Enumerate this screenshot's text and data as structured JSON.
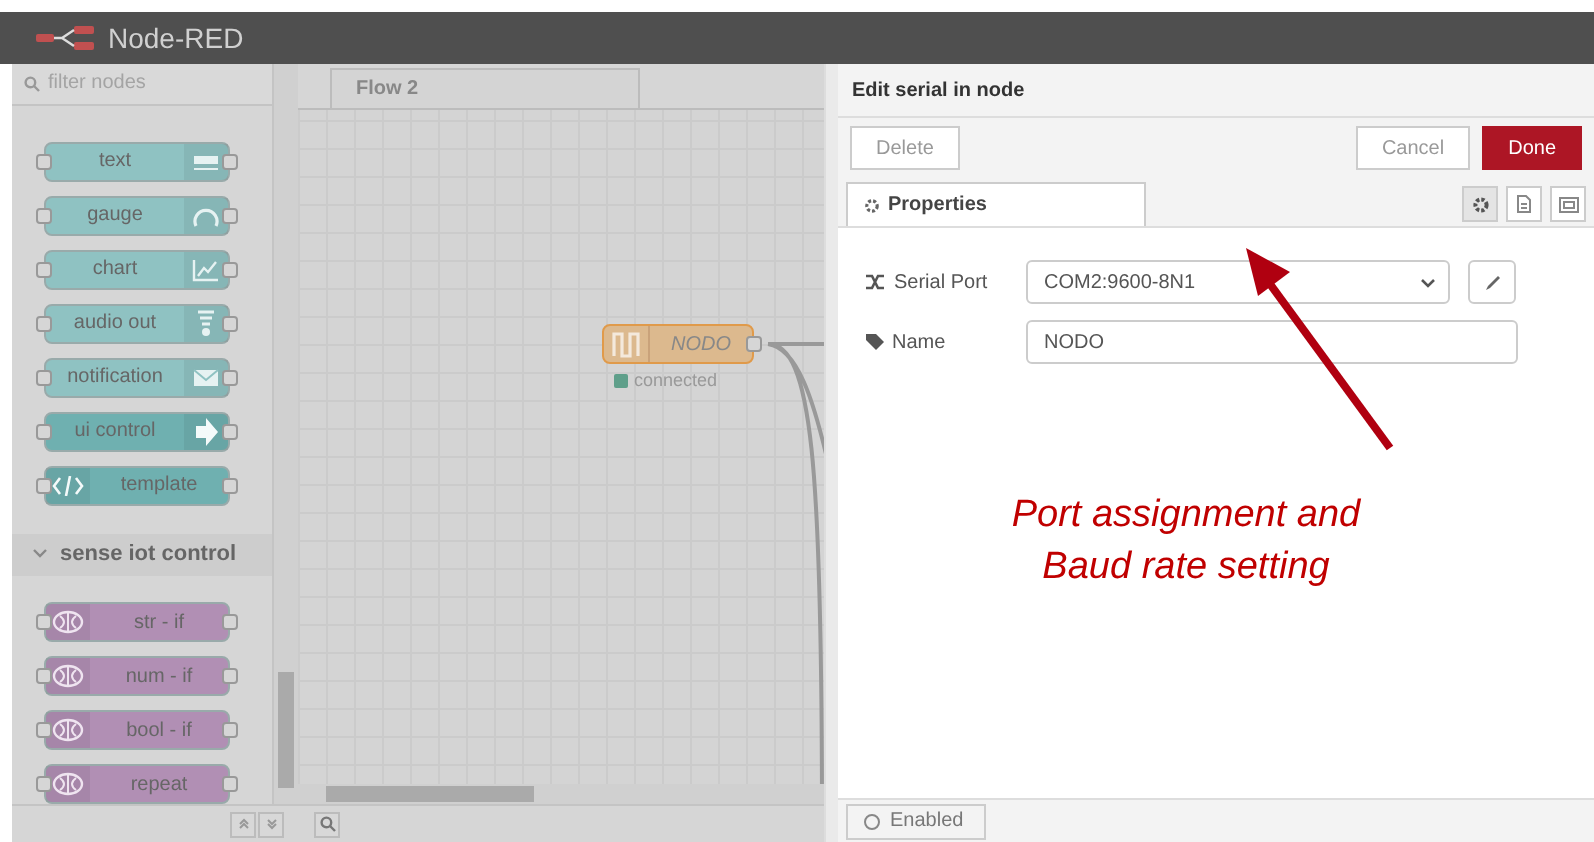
{
  "header": {
    "title": "Node-RED"
  },
  "palette": {
    "filter_placeholder": "filter nodes",
    "nodes": [
      {
        "label": "text",
        "color": "#8fc2c2"
      },
      {
        "label": "gauge",
        "color": "#8fc2c2"
      },
      {
        "label": "chart",
        "color": "#8fc2c2"
      },
      {
        "label": "audio out",
        "color": "#8fc2c2"
      },
      {
        "label": "notification",
        "color": "#8fc2c2"
      },
      {
        "label": "ui control",
        "color": "#6fb0b0"
      },
      {
        "label": "template",
        "color": "#6fb0b0"
      }
    ],
    "category": {
      "label": "sense iot control",
      "expanded": true
    },
    "category_nodes": [
      {
        "label": "str - if",
        "color": "#b18fb4"
      },
      {
        "label": "num - if",
        "color": "#b18fb4"
      },
      {
        "label": "bool - if",
        "color": "#b18fb4"
      },
      {
        "label": "repeat",
        "color": "#b18fb4"
      }
    ]
  },
  "workspace": {
    "tabs": [
      {
        "label": "Flow 2",
        "selected": true
      }
    ],
    "node": {
      "label": "NODO",
      "status": {
        "text": "connected",
        "color": "#5f9f8a"
      }
    }
  },
  "editor": {
    "title": "Edit serial in node",
    "buttons": [
      {
        "label": "Delete",
        "kind": "plain"
      },
      {
        "label": "Cancel",
        "kind": "plain"
      },
      {
        "label": "Done",
        "kind": "primary"
      }
    ],
    "tabs": [
      {
        "label": "Properties",
        "selected": true
      }
    ],
    "fields": [
      {
        "label": "Serial Port",
        "kind": "select",
        "value": "COM2:9600-8N1"
      },
      {
        "label": "Name",
        "kind": "text",
        "value": "NODO"
      }
    ],
    "enabled": {
      "label": "Enabled",
      "on": false
    }
  },
  "annotation": {
    "text": "Port assignment and Baud rate setting"
  }
}
